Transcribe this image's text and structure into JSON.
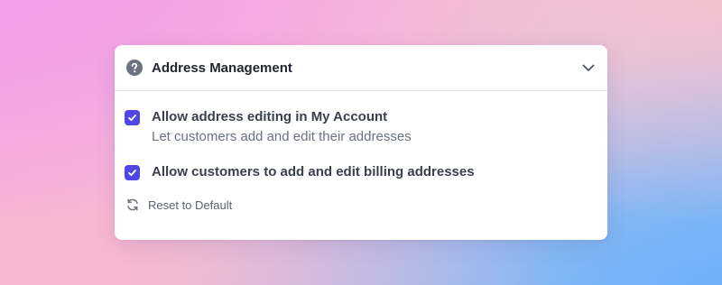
{
  "card": {
    "title": "Address Management",
    "help_icon": "question-circle-icon",
    "collapse_icon": "chevron-down-icon"
  },
  "options": [
    {
      "label": "Allow address editing in My Account",
      "description": "Let customers add and edit their addresses",
      "checked": true
    },
    {
      "label": "Allow customers to add and edit billing addresses",
      "checked": true
    }
  ],
  "reset": {
    "label": "Reset to Default",
    "icon": "refresh-icon"
  },
  "colors": {
    "accent": "#5046e5",
    "title_text": "#1f2430",
    "muted_text": "#6b7280"
  }
}
